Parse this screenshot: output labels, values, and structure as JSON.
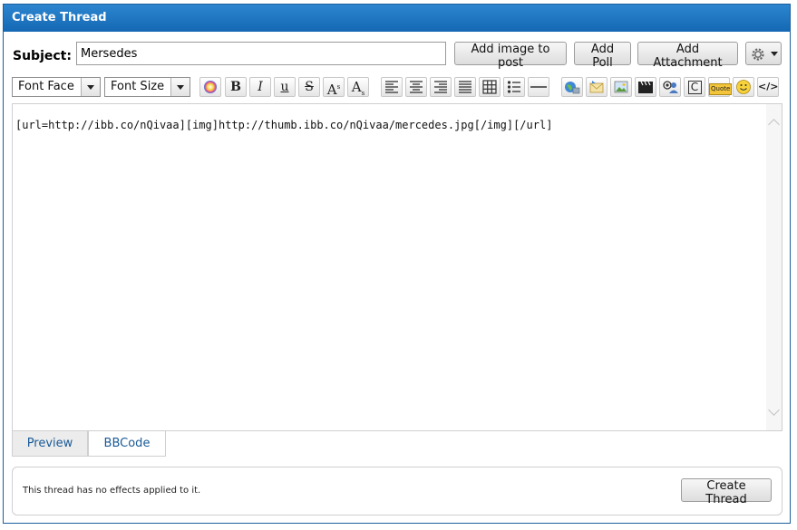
{
  "window": {
    "title": "Create Thread"
  },
  "subject": {
    "label": "Subject:",
    "value": "Mersedes"
  },
  "buttons": {
    "add_image": "Add image to post",
    "add_poll": "Add Poll",
    "add_attachment": "Add Attachment",
    "create_thread": "Create Thread"
  },
  "toolbar": {
    "font_face": "Font Face",
    "font_size": "Font Size",
    "bold": "B",
    "italic": "I",
    "underline": "u",
    "strike": "S",
    "superscript": "A",
    "sup_mark": "s",
    "subscript": "A",
    "sub_mark": "s",
    "code": "C",
    "quote": "Quote",
    "source": "</>"
  },
  "editor": {
    "content": "[url=http://ibb.co/nQivaa][img]http://thumb.ibb.co/nQivaa/mercedes.jpg[/img][/url]"
  },
  "tabs": [
    {
      "label": "Preview"
    },
    {
      "label": "BBCode"
    }
  ],
  "footer": {
    "text": "This thread has no effects applied to it."
  }
}
